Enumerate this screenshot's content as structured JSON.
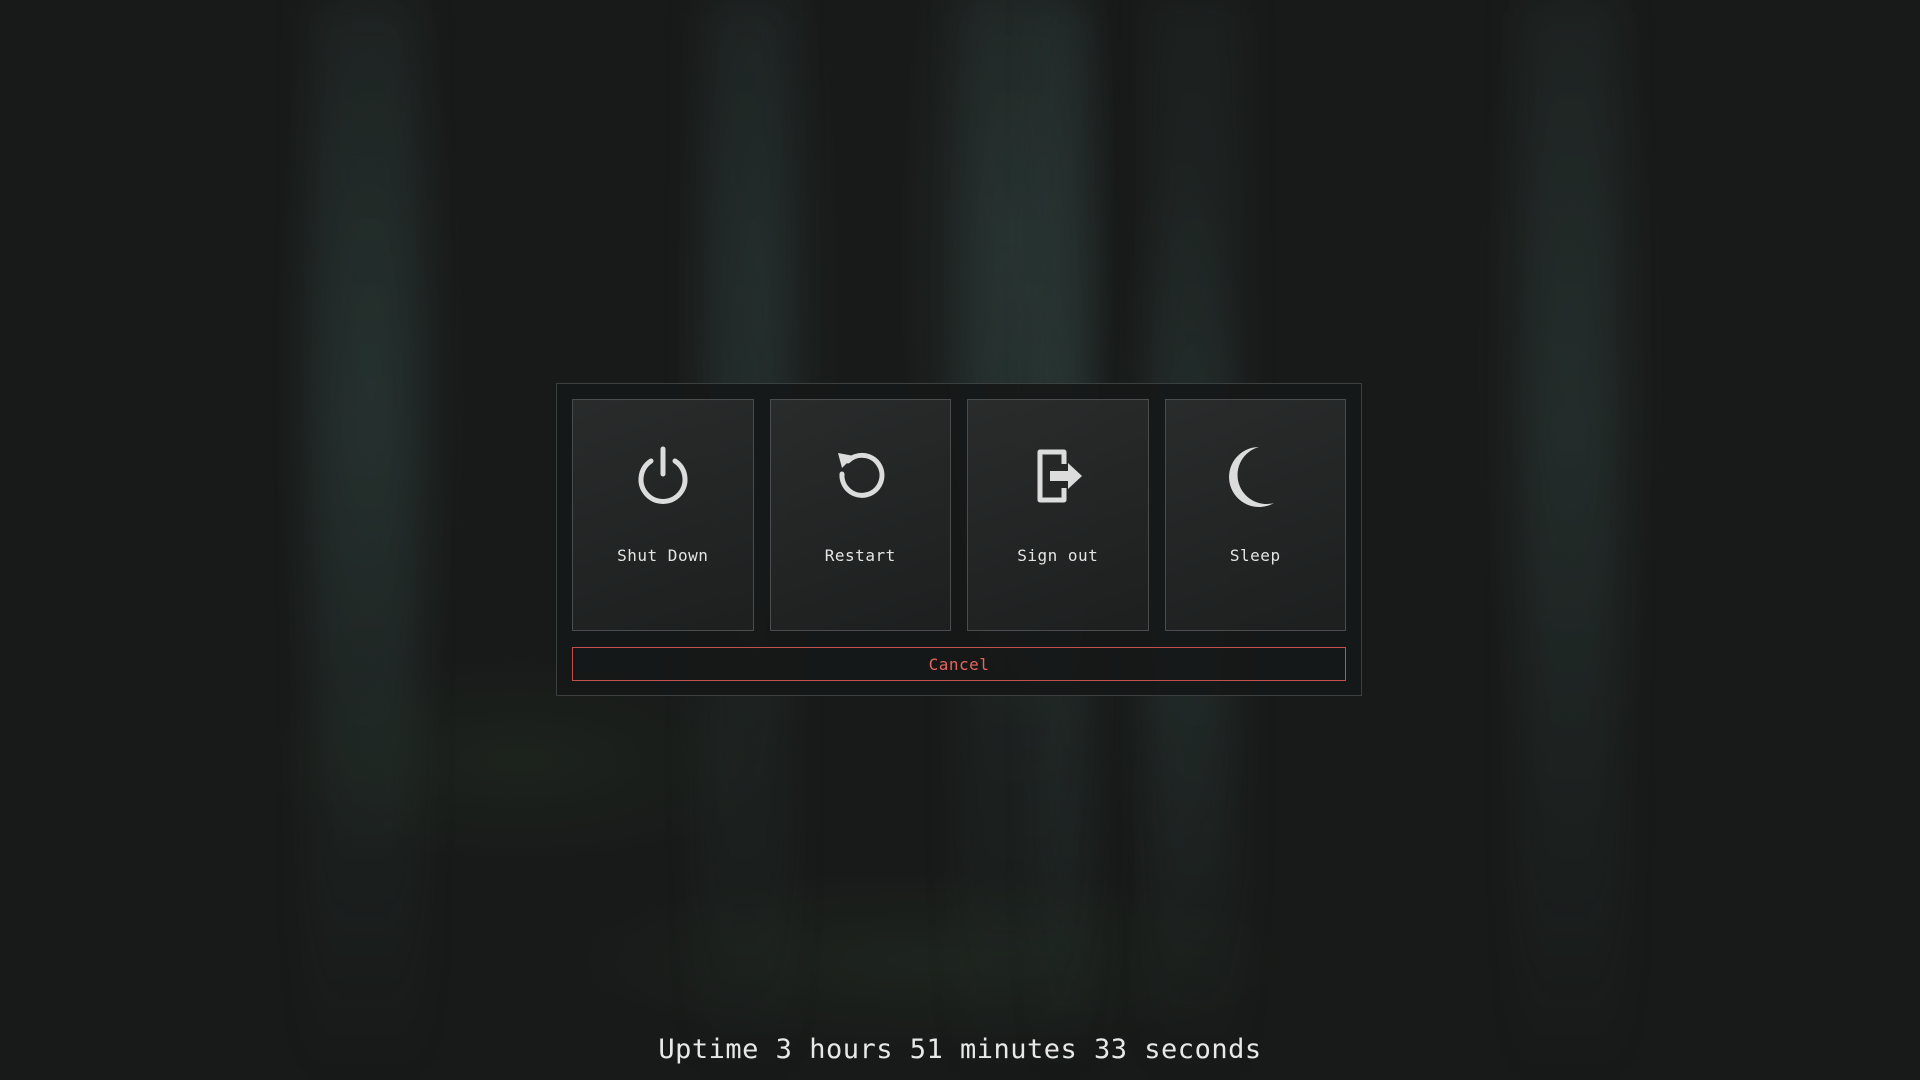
{
  "options": [
    {
      "label": "Shut Down",
      "icon": "power-icon"
    },
    {
      "label": "Restart",
      "icon": "restart-icon"
    },
    {
      "label": "Sign out",
      "icon": "sign-out-icon"
    },
    {
      "label": "Sleep",
      "icon": "moon-icon"
    }
  ],
  "cancel_label": "Cancel",
  "uptime": "Uptime 3 hours 51 minutes 33 seconds",
  "colors": {
    "cancel_accent": "#e4655f",
    "icon": "#dcdcdc",
    "dialog_border": "#3a3f3f"
  }
}
